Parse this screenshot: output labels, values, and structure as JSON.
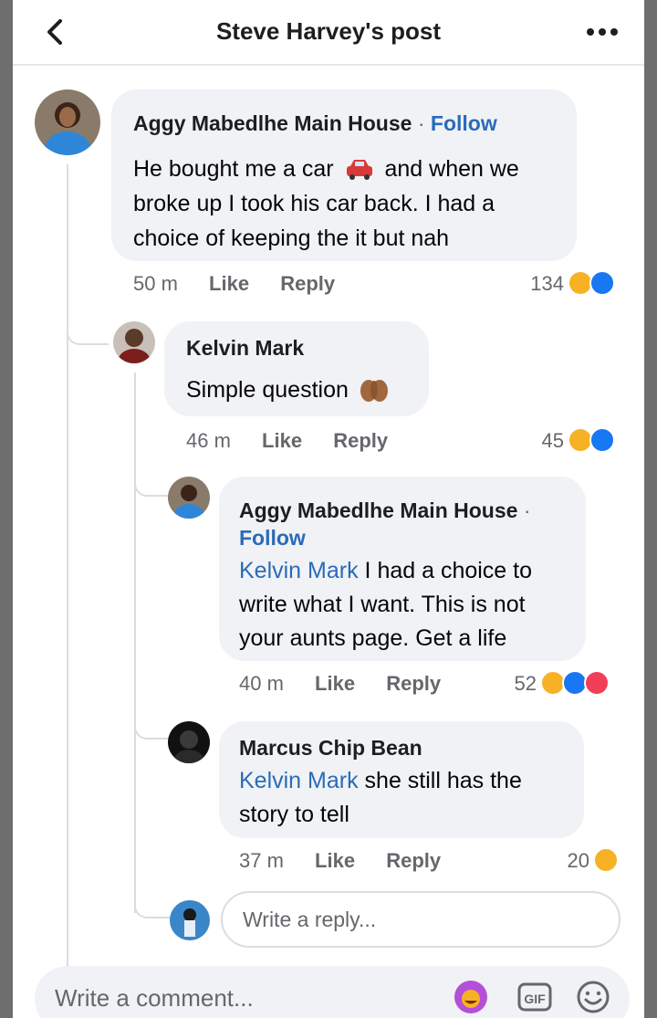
{
  "header": {
    "title": "Steve Harvey's post"
  },
  "comments": [
    {
      "author": "Aggy Mabedlhe Main House",
      "follow": "Follow",
      "separator": "·",
      "lines": [
        "He bought me a car",
        "and when we",
        "broke up I took his car back. I had a",
        "choice of keeping the it but nah"
      ],
      "time": "50 m",
      "like": "Like",
      "reply": "Reply",
      "reactions": "134"
    },
    {
      "author": "Kelvin Mark",
      "lines": [
        "Simple question"
      ],
      "time": "46 m",
      "like": "Like",
      "reply": "Reply",
      "reactions": "45"
    },
    {
      "author": "Aggy Mabedlhe Main House",
      "separator": "·",
      "follow": "Follow",
      "mention": "Kelvin Mark",
      "lines": [
        "I had a choice to",
        "write what I want. This is not",
        "your aunts page. Get a life"
      ],
      "time": "40 m",
      "like": "Like",
      "reply": "Reply",
      "reactions": "52"
    },
    {
      "author": "Marcus Chip Bean",
      "mention": "Kelvin Mark",
      "lines": [
        "she still has the",
        "story to tell"
      ],
      "time": "37 m",
      "like": "Like",
      "reply": "Reply",
      "reactions": "20"
    }
  ],
  "reply_input": {
    "placeholder": "Write a reply..."
  },
  "comment_input": {
    "placeholder": "Write a comment..."
  },
  "colors": {
    "link": "#2a6bb8",
    "like_blue": "#1877f2",
    "haha_yellow": "#f7b125",
    "love_red": "#f33e58",
    "bubble": "#f0f2f5"
  },
  "icons": [
    "back-arrow-icon",
    "more-dots-icon",
    "car-emoji-icon",
    "praying-hands-emoji-icon",
    "haha-reaction-icon",
    "like-reaction-icon",
    "love-reaction-icon",
    "avatar-sticker-icon",
    "gif-icon",
    "smiley-icon"
  ]
}
